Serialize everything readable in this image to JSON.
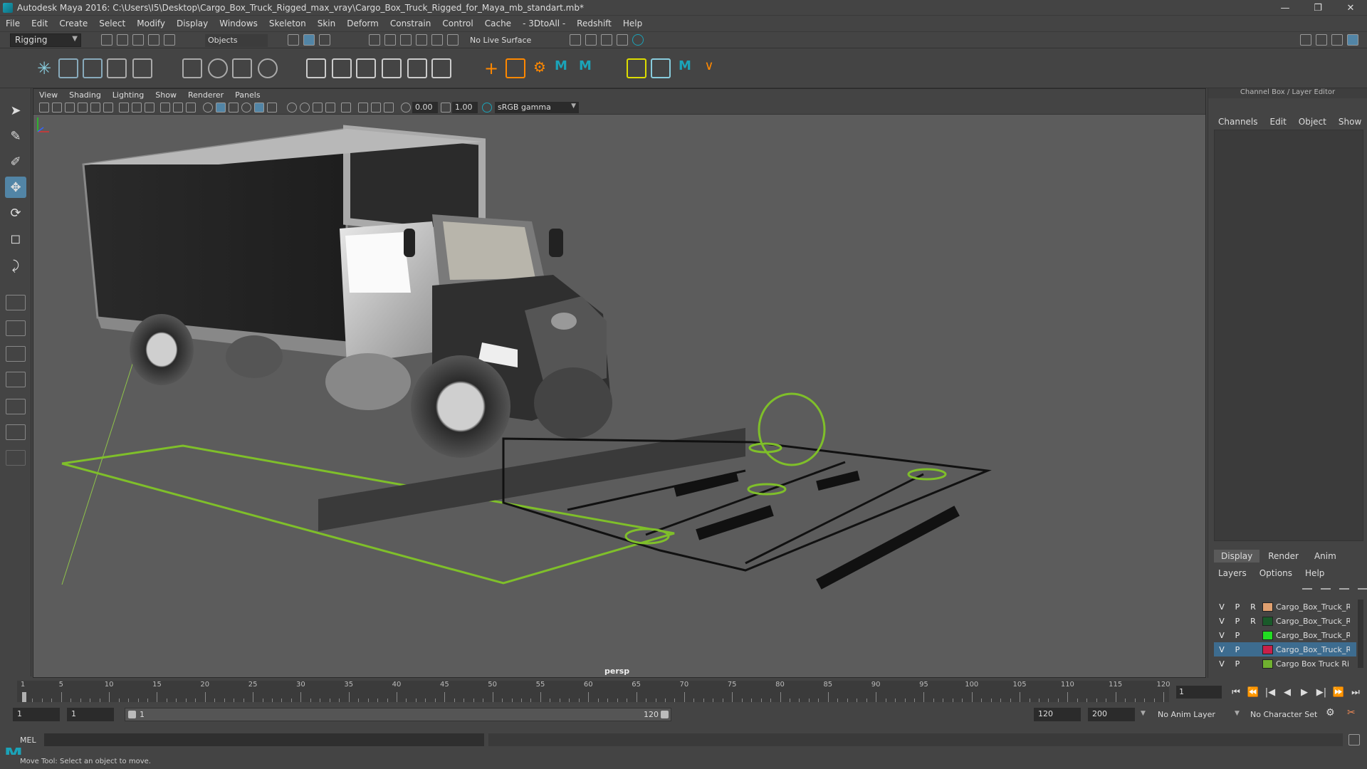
{
  "window": {
    "title": "Autodesk Maya 2016: C:\\Users\\I5\\Desktop\\Cargo_Box_Truck_Rigged_max_vray\\Cargo_Box_Truck_Rigged_for_Maya_mb_standart.mb*",
    "minimize": "—",
    "maximize": "❐",
    "close": "✕"
  },
  "menu": [
    "File",
    "Edit",
    "Create",
    "Select",
    "Modify",
    "Display",
    "Windows",
    "Skeleton",
    "Skin",
    "Deform",
    "Constrain",
    "Control",
    "Cache",
    "- 3DtoAll -",
    "Redshift",
    "Help"
  ],
  "status_line": {
    "mode": "Rigging",
    "selection_field": "Objects",
    "live_surface": "No Live Surface"
  },
  "viewport_panel": {
    "menu": [
      "View",
      "Shading",
      "Lighting",
      "Show",
      "Renderer",
      "Panels"
    ],
    "exposure": "0.00",
    "gamma": "1.00",
    "color_space": "sRGB gamma",
    "camera": "persp"
  },
  "channel_box": {
    "header": "Channel Box / Layer Editor",
    "menu": [
      "Channels",
      "Edit",
      "Object",
      "Show"
    ]
  },
  "layer_editor": {
    "tabs": [
      "Display",
      "Render",
      "Anim"
    ],
    "active_tab": "Display",
    "menu": [
      "Layers",
      "Options",
      "Help"
    ],
    "layers": [
      {
        "v": "V",
        "p": "P",
        "r": "R",
        "color": "#e0a070",
        "name": "Cargo_Box_Truck_Ri",
        "selected": false
      },
      {
        "v": "V",
        "p": "P",
        "r": "R",
        "color": "#1a5a2a",
        "name": "Cargo_Box_Truck_Ri",
        "selected": false
      },
      {
        "v": "V",
        "p": "P",
        "r": "",
        "color": "#22dd22",
        "name": "Cargo_Box_Truck_Ri",
        "selected": false
      },
      {
        "v": "V",
        "p": "P",
        "r": "",
        "color": "#c8204a",
        "name": "Cargo_Box_Truck_Ri",
        "selected": true
      },
      {
        "v": "V",
        "p": "P",
        "r": "",
        "color": "#70b030",
        "name": "Cargo Box Truck Ri",
        "selected": false
      }
    ]
  },
  "time_slider": {
    "ticks": [
      "1",
      "5",
      "10",
      "15",
      "20",
      "25",
      "30",
      "35",
      "40",
      "45",
      "50",
      "55",
      "60",
      "65",
      "70",
      "75",
      "80",
      "85",
      "90",
      "95",
      "100",
      "105",
      "110",
      "115",
      "120"
    ],
    "current_frame": "1",
    "playback_icons": [
      "⏮",
      "⏪",
      "|◀",
      "◀",
      "▶",
      "▶|",
      "⏩",
      "⏭"
    ]
  },
  "range_slider": {
    "start_time": "1",
    "playback_start": "1",
    "range_left": "1",
    "range_right": "120",
    "playback_end": "120",
    "end_time": "200",
    "anim_layer": "No Anim Layer",
    "character_set": "No Character Set"
  },
  "command_line": {
    "label": "MEL"
  },
  "help_line": "Move Tool: Select an object to move."
}
